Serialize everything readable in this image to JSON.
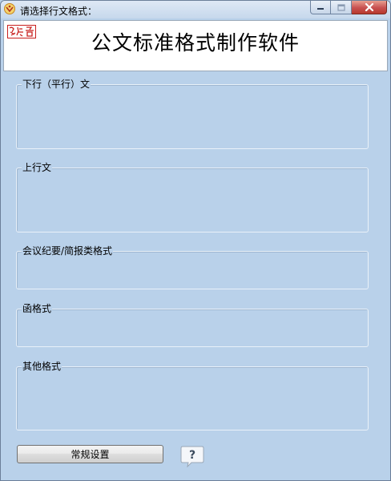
{
  "window": {
    "title": "请选择行文格式："
  },
  "header": {
    "title": "公文标准格式制作软件"
  },
  "groups": [
    {
      "label": "下行（平行）文"
    },
    {
      "label": "上行文"
    },
    {
      "label": "会议纪要/简报类格式"
    },
    {
      "label": "函格式"
    },
    {
      "label": "其他格式"
    }
  ],
  "footer": {
    "settings_label": "常规设置",
    "help_label": "?"
  },
  "colors": {
    "background": "#b9d1ea",
    "seal_red": "#c8201e"
  }
}
